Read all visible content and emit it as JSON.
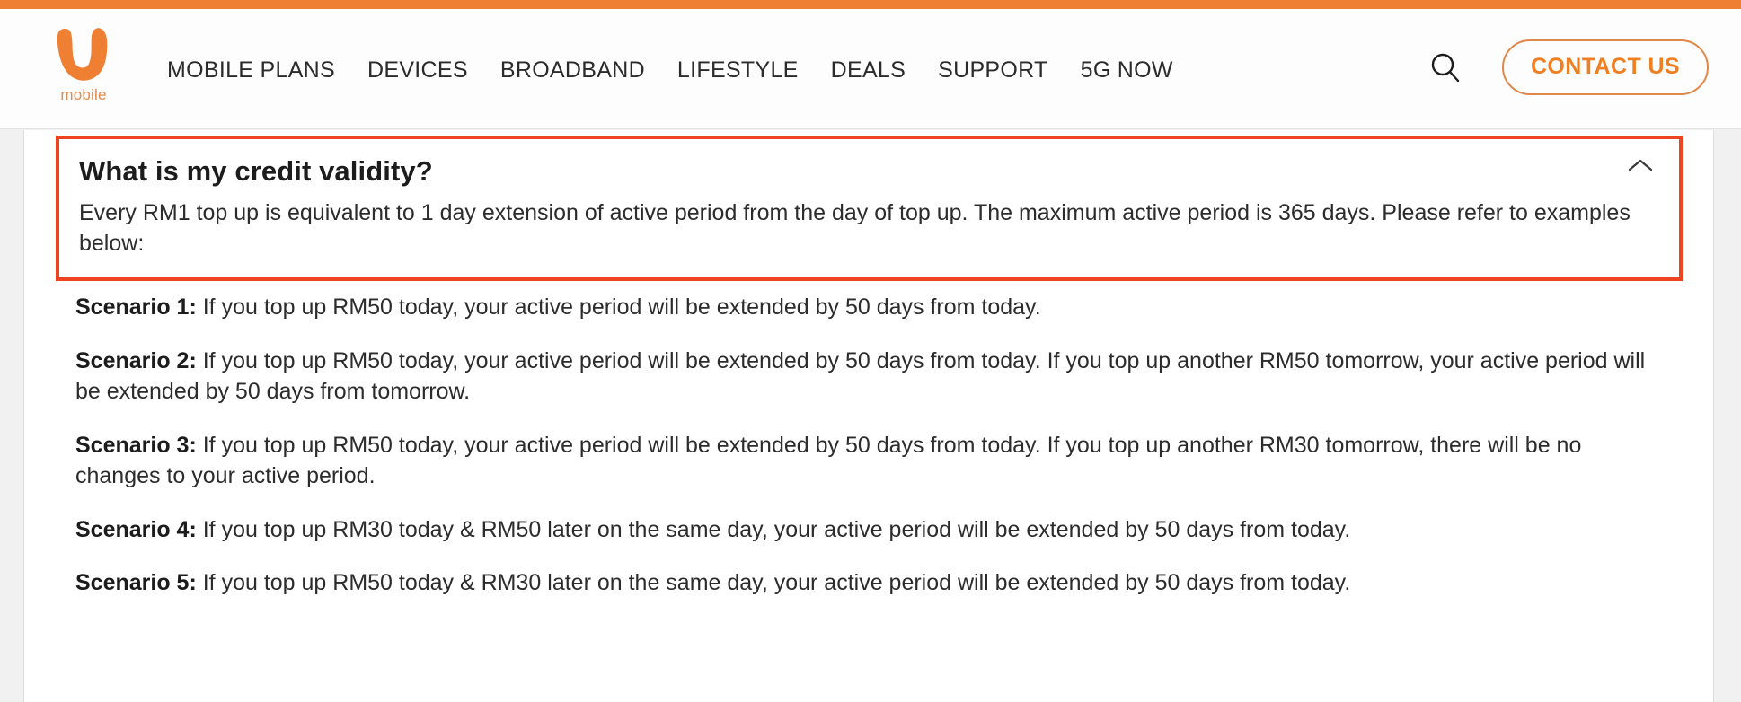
{
  "brand": {
    "name": "u mobile",
    "logo_word": "mobile",
    "accent_orange": "#ee7f22",
    "strip_orange": "#ef8033",
    "highlight_red": "#ee4422"
  },
  "header": {
    "nav_items": [
      {
        "label": "MOBILE PLANS"
      },
      {
        "label": "DEVICES"
      },
      {
        "label": "BROADBAND"
      },
      {
        "label": "LIFESTYLE"
      },
      {
        "label": "DEALS"
      },
      {
        "label": "SUPPORT"
      },
      {
        "label": "5G NOW"
      }
    ],
    "search_icon": "search-icon",
    "contact_button": "CONTACT US"
  },
  "faq": {
    "question": "What is my credit validity?",
    "answer": "Every RM1 top up is equivalent to 1 day extension of active period from the day of top up. The maximum active period is 365 days. Please refer to examples below:",
    "toggle_icon": "chevron-up-icon",
    "expanded": true,
    "scenarios": [
      {
        "label": "Scenario 1:",
        "text": " If you top up RM50 today, your active period will be extended by 50 days from today."
      },
      {
        "label": "Scenario 2:",
        "text": " If you top up RM50 today, your active period will be extended by 50 days from today. If you top up another RM50 tomorrow, your active period will be extended by 50 days from tomorrow."
      },
      {
        "label": "Scenario 3:",
        "text": " If you top up RM50 today, your active period will be extended by 50 days from today. If you top up another RM30 tomorrow, there will be no changes to your active period."
      },
      {
        "label": "Scenario 4:",
        "text": " If you top up RM30 today & RM50 later on the same day, your active period will be extended by 50 days from today."
      },
      {
        "label": "Scenario 5:",
        "text": " If you top up RM50 today & RM30 later on the same day, your active period will be extended by 50 days from today."
      }
    ]
  }
}
